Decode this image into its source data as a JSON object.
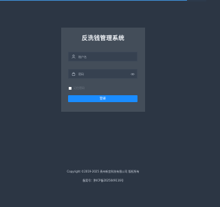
{
  "app": {
    "title": "反洗钱管理系统"
  },
  "login": {
    "username": {
      "value": "",
      "placeholder": "账户名",
      "icon": "user-icon"
    },
    "password": {
      "value": "",
      "placeholder": "密码",
      "icon": "lock-icon",
      "toggle_icon": "eye-icon"
    },
    "remember_label": "记住密码",
    "submit_label": "登录"
  },
  "footer": {
    "copyright": "Copyright ©2019-2025 贵州新宜科技有限公司 版权所有",
    "icp": "备案号：黔ICP备2025049116号"
  },
  "colors": {
    "background": "#2c3644",
    "card": "#434d59",
    "input": "#364150",
    "accent": "#1a8cff",
    "top_accent": "#3f8fd6"
  }
}
